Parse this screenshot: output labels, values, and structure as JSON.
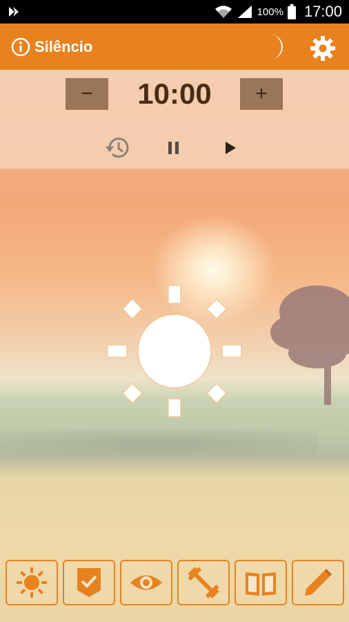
{
  "status_bar": {
    "battery_text": "100%",
    "time": "17:00",
    "icons": [
      "app-notification-icon",
      "wifi-icon",
      "signal-icon",
      "battery-icon"
    ]
  },
  "app_bar": {
    "title": "Silêncio",
    "icons": [
      "info-icon",
      "moon-icon",
      "gear-icon"
    ]
  },
  "timer": {
    "minus_label": "−",
    "plus_label": "+",
    "value": "10:00"
  },
  "playback": {
    "icons": [
      "history-icon",
      "pause-icon",
      "play-icon"
    ]
  },
  "center": {
    "icon": "sun-icon"
  },
  "bottom_tabs": [
    {
      "icon": "sun-tab-icon"
    },
    {
      "icon": "checkmark-badge-icon"
    },
    {
      "icon": "eye-icon"
    },
    {
      "icon": "dumbbell-icon"
    },
    {
      "icon": "book-icon"
    },
    {
      "icon": "pencil-icon"
    }
  ],
  "colors": {
    "accent": "#e8821f",
    "timer_text": "#4a2c14",
    "button_bg": "#9a7557"
  }
}
